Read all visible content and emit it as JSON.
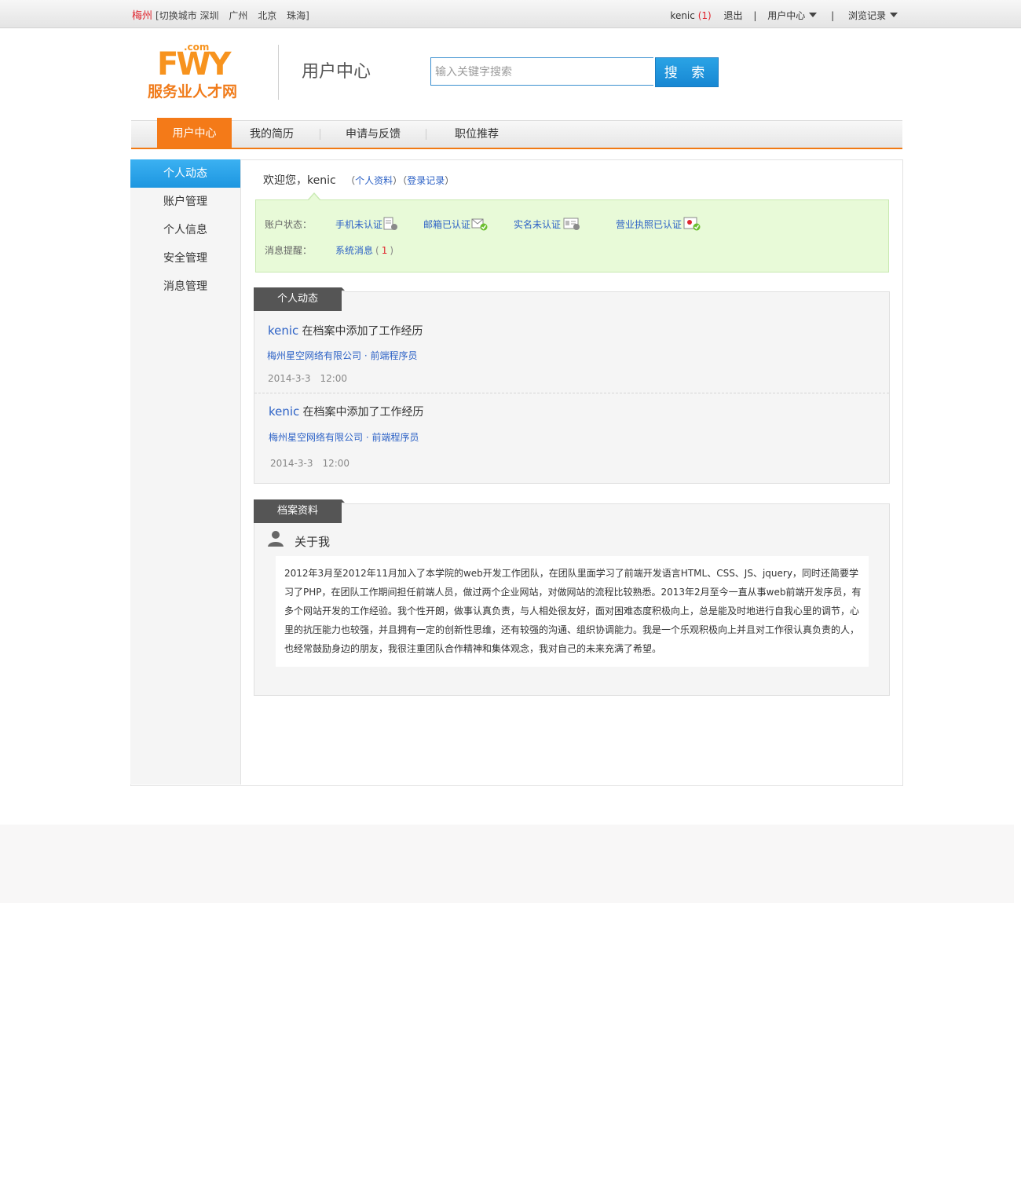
{
  "topbar": {
    "current_city": "梅州",
    "switch_text": "[切换城市",
    "cities": [
      "深圳",
      "广州",
      "北京",
      "珠海]"
    ],
    "username": "kenic",
    "msg_count_open": "(",
    "msg_count": "1",
    "msg_count_close": ")",
    "logout": "退出",
    "sep": "|",
    "user_center": "用户中心",
    "history": "浏览记录"
  },
  "header": {
    "logo_domain": ".com",
    "logo_letters": "FWY",
    "logo_text": "服务业人才网",
    "title": "用户中心",
    "search_placeholder": "输入关键字搜索",
    "search_button": "搜 索"
  },
  "nav": {
    "items": [
      "用户中心",
      "我的简历",
      "申请与反馈",
      "职位推荐"
    ],
    "sep": "|"
  },
  "sidebar": {
    "items": [
      "个人动态",
      "账户管理",
      "个人信息",
      "安全管理",
      "消息管理"
    ]
  },
  "welcome": {
    "greeting": "欢迎您，kenic",
    "open": "（",
    "profile_link": "个人资料",
    "mid": "）（",
    "login_record_link": "登录记录",
    "close": "）"
  },
  "status": {
    "account_label": "账户状态：",
    "phone": "手机未认证",
    "email": "邮箱已认证",
    "realname": "实名未认证",
    "license": "营业执照已认证",
    "message_label": "消息提醒：",
    "system_msg": "系统消息",
    "sys_open": "(",
    "sys_count": "1",
    "sys_close": ")"
  },
  "activity": {
    "tab": "个人动态",
    "items": [
      {
        "user": "kenic",
        "action": "在档案中添加了工作经历",
        "detail": "梅州星空网络有限公司 · 前端程序员",
        "time": "2014-3-3　12:00"
      },
      {
        "user": "kenic",
        "action": "在档案中添加了工作经历",
        "detail": "梅州星空网络有限公司 · 前端程序员",
        "time": "2014-3-3　12:00"
      }
    ]
  },
  "profile": {
    "tab": "档案资料",
    "about_title": "关于我",
    "about_text": "2012年3月至2012年11月加入了本学院的web开发工作团队，在团队里面学习了前端开发语言HTML、CSS、JS、jquery，同时还简要学习了PHP，在团队工作期间担任前端人员，做过两个企业网站，对做网站的流程比较熟悉。2013年2月至今一直从事web前端开发序员，有多个网站开发的工作经验。我个性开朗，做事认真负责，与人相处很友好，面对困难态度积极向上，总是能及时地进行自我心里的调节，心里的抗压能力也较强，并且拥有一定的创新性思维，还有较强的沟通、组织协调能力。我是一个乐观积极向上并且对工作很认真负责的人，也经常鼓励身边的朋友，我很注重团队合作精神和集体观念，我对自己的未来充满了希望。"
  },
  "colors": {
    "brand_orange": "#f47a18",
    "link_blue": "#2d62c6",
    "search_blue": "#1d96e0",
    "status_green_bg": "#e8fad8"
  }
}
